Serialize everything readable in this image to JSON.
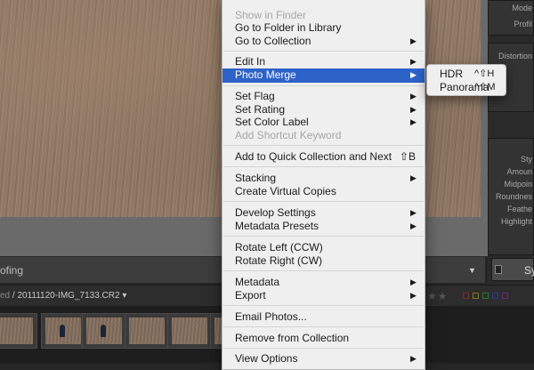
{
  "background": {
    "toolbar_label": "ofing",
    "filmstrip_prefix": "ed",
    "filmstrip_filename": " / 20111120-IMG_7133.CR2",
    "filmstrip_arrow": "▾",
    "stars": "★★",
    "sync_label": "Sy",
    "right_panel_labels": [
      "Mode",
      "Profil",
      "Distortion",
      "Sty",
      "Amoun",
      "Midpoin",
      "Roundnes",
      "Feathe",
      "Highlight"
    ]
  },
  "menu": {
    "items": [
      {
        "label": "Show in Finder",
        "disabled": true
      },
      {
        "label": "Go to Folder in Library"
      },
      {
        "label": "Go to Collection",
        "submenu": true
      },
      {
        "label": "Edit In",
        "submenu": true
      },
      {
        "label": "Photo Merge",
        "submenu": true,
        "highlighted": true
      },
      {
        "label": "Set Flag",
        "submenu": true
      },
      {
        "label": "Set Rating",
        "submenu": true
      },
      {
        "label": "Set Color Label",
        "submenu": true
      },
      {
        "label": "Add Shortcut Keyword",
        "disabled": true
      },
      {
        "label": "Add to Quick Collection and Next",
        "shortcut": "⇧B"
      },
      {
        "label": "Stacking",
        "submenu": true
      },
      {
        "label": "Create Virtual Copies"
      },
      {
        "label": "Develop Settings",
        "submenu": true
      },
      {
        "label": "Metadata Presets",
        "submenu": true
      },
      {
        "label": "Rotate Left (CCW)"
      },
      {
        "label": "Rotate Right (CW)"
      },
      {
        "label": "Metadata",
        "submenu": true
      },
      {
        "label": "Export",
        "submenu": true
      },
      {
        "label": "Email Photos..."
      },
      {
        "label": "Remove from Collection"
      },
      {
        "label": "View Options",
        "submenu": true
      }
    ],
    "submenu_arrow": "▶"
  },
  "submenu": {
    "items": [
      {
        "label": "HDR",
        "shortcut": "^⇧H"
      },
      {
        "label": "Panorama",
        "shortcut": "^⇧M"
      }
    ]
  },
  "colors": {
    "highlight": "#2d62c8",
    "menu_bg": "#efefef",
    "disabled_text": "#a6a6a6"
  }
}
